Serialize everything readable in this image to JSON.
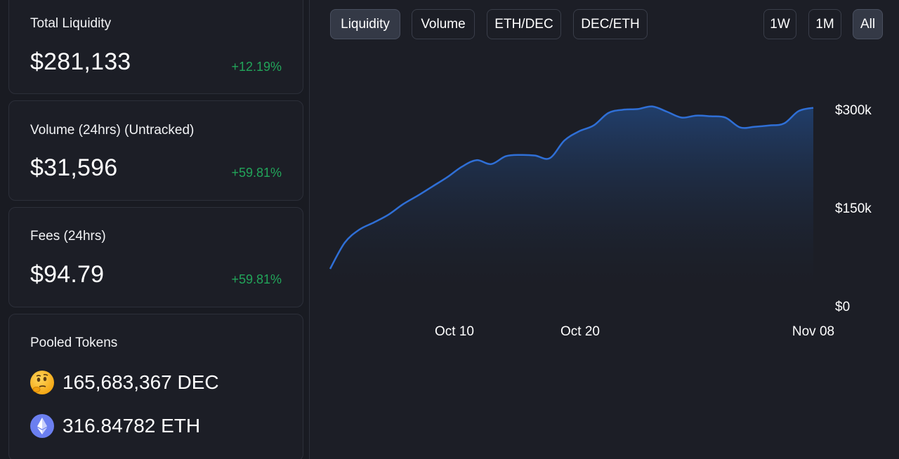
{
  "stats": {
    "liquidity": {
      "label": "Total Liquidity",
      "value": "$281,133",
      "change": "+12.19%"
    },
    "volume": {
      "label": "Volume (24hrs) (Untracked)",
      "value": "$31,596",
      "change": "+59.81%"
    },
    "fees": {
      "label": "Fees (24hrs)",
      "value": "$94.79",
      "change": "+59.81%"
    }
  },
  "pooled": {
    "label": "Pooled Tokens",
    "tokens": [
      {
        "amount": "165,683,367 DEC",
        "icon": "thinking-face-emoji-icon"
      },
      {
        "amount": "316.84782 ETH",
        "icon": "ethereum-icon"
      }
    ]
  },
  "chart_tabs": {
    "liquidity": "Liquidity",
    "volume": "Volume",
    "eth_dec": "ETH/DEC",
    "dec_eth": "DEC/ETH",
    "active": "Liquidity"
  },
  "range_tabs": {
    "w1": "1W",
    "m1": "1M",
    "all": "All",
    "active": "All"
  },
  "colors": {
    "accent_line": "#2f6fd6",
    "positive": "#22a55a",
    "background": "#191b22",
    "card": "#1c1e26"
  },
  "chart_data": {
    "type": "area",
    "ylim": [
      0,
      300000
    ],
    "y_ticks": [
      {
        "value": 300000,
        "label": "$300k"
      },
      {
        "value": 150000,
        "label": "$150k"
      },
      {
        "value": 0,
        "label": "$0"
      }
    ],
    "x_ticks": [
      "Oct 10",
      "Oct 20",
      "Nov 08"
    ],
    "series": [
      {
        "values": [
          32000,
          72000,
          92000,
          103000,
          115000,
          131000,
          144000,
          158000,
          172000,
          188000,
          198000,
          192000,
          204000,
          206000,
          205000,
          201000,
          228000,
          242000,
          251000,
          270000,
          275000,
          276000,
          280000,
          272000,
          263000,
          266000,
          265000,
          263000,
          248000,
          249000,
          251000,
          254000,
          273000,
          278000
        ]
      }
    ]
  }
}
